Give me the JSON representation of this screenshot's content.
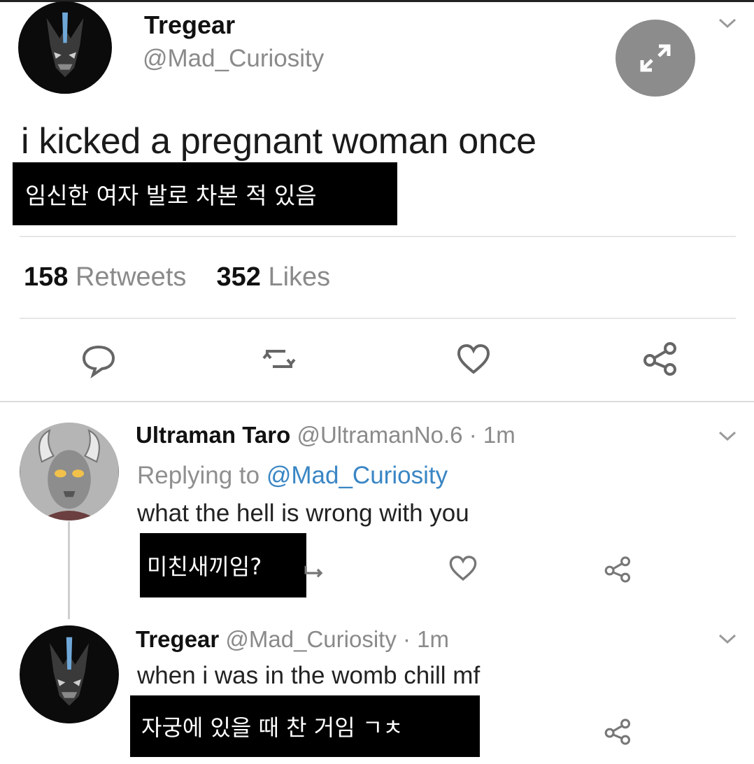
{
  "tweet": {
    "author_name": "Tregear",
    "author_handle": "@Mad_Curiosity",
    "text": "i kicked a pregnant woman once",
    "caption_ko": "임신한 여자 발로 차본 적 있음",
    "retweets_count": "158",
    "retweets_label": "Retweets",
    "likes_count": "352",
    "likes_label": "Likes",
    "icons": [
      "reply-icon",
      "retweet-icon",
      "like-icon",
      "share-icon",
      "expand-icon",
      "chevron-down-icon"
    ]
  },
  "replies": [
    {
      "author_name": "Ultraman Taro",
      "author_handle": "@UltramanNo.6",
      "time": "· 1m",
      "replying_label": "Replying to",
      "replying_to": "@Mad_Curiosity",
      "text": "what the hell is wrong with you",
      "caption_ko": "미친새끼임?"
    },
    {
      "author_name": "Tregear",
      "author_handle": "@Mad_Curiosity",
      "time": "· 1m",
      "text": "when i was in the womb chill mf",
      "caption_ko": "자궁에 있을 때 찬 거임 ㄱㅊ"
    }
  ],
  "colors": {
    "link": "#3a86c4",
    "muted": "#8a8a8a",
    "caption_bg": "#000000",
    "expand_button": "#8c8c8c"
  }
}
